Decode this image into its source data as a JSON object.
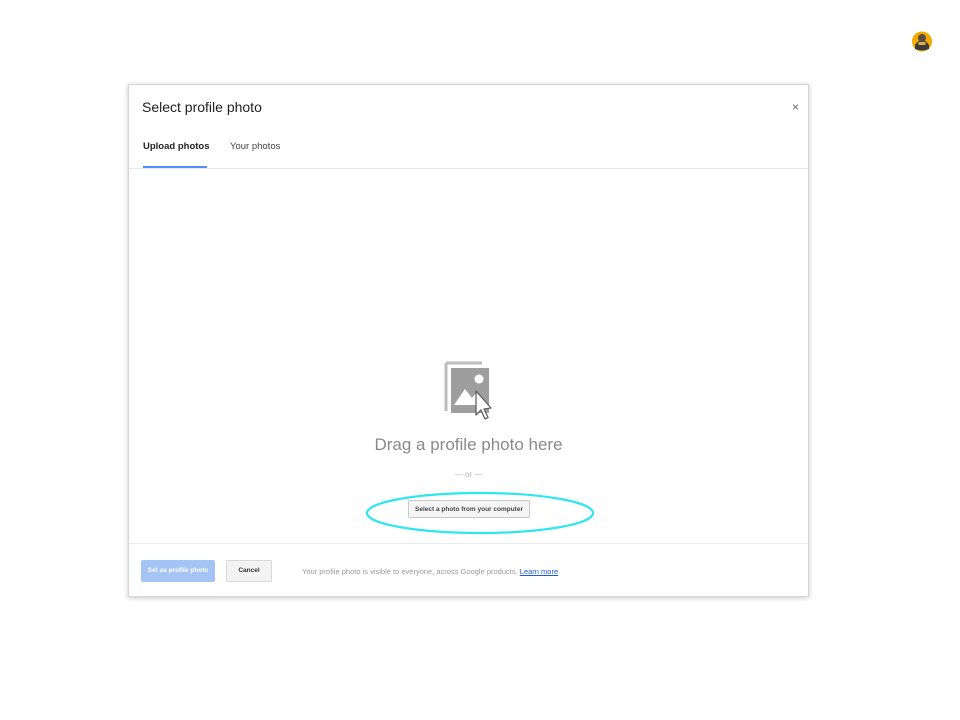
{
  "dialog": {
    "title": "Select profile photo",
    "close_label": "×",
    "tabs": [
      {
        "label": "Upload photos",
        "active": true
      },
      {
        "label": "Your photos",
        "active": false
      }
    ],
    "drop_zone": {
      "icon": "photo-drag-icon",
      "drag_text": "Drag a profile photo here",
      "or_text": "— or —",
      "select_button_label": "Select a photo from your computer"
    },
    "footer": {
      "set_button_label": "Set as profile photo",
      "cancel_button_label": "Cancel",
      "note_text": "Your profile photo is visible to everyone, across Google products.",
      "learn_more_label": "Learn more"
    }
  },
  "user_avatar": {
    "icon": "user-avatar-icon"
  },
  "colors": {
    "accent": "#4d90fe",
    "primary_disabled": "#a5c4f6",
    "link": "#1a5ad8",
    "highlight_annotation": "#2ee6f0"
  }
}
